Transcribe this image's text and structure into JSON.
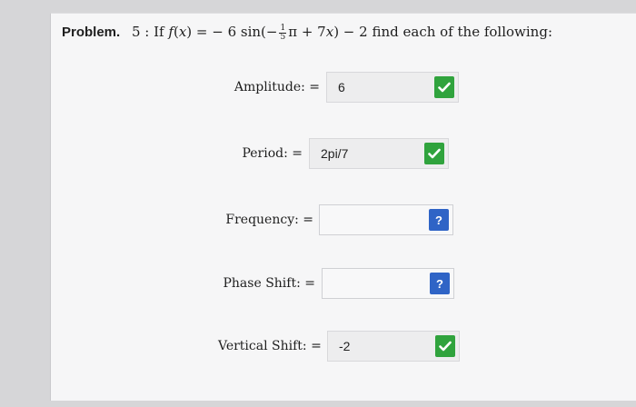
{
  "problem": {
    "label": "Problem.",
    "number": "5",
    "prefix": ": If",
    "func": "f",
    "var": "x",
    "eq_coef": "= − 6 sin",
    "open": "(−",
    "frac_num": "1",
    "frac_den": "5",
    "pi_plus": "π + 7",
    "close_minus": ") − 2",
    "suffix": "find each of the following:"
  },
  "fields": [
    {
      "label": "Amplitude: =",
      "value": "6",
      "status": "correct"
    },
    {
      "label": "Period: =",
      "value": "2pi/7",
      "status": "correct"
    },
    {
      "label": "Frequency: =",
      "value": "",
      "status": "unknown",
      "status_glyph": "?"
    },
    {
      "label": "Phase Shift: =",
      "value": "",
      "status": "unknown",
      "status_glyph": "?"
    },
    {
      "label": "Vertical Shift: =",
      "value": "-2",
      "status": "correct"
    }
  ],
  "icons": {
    "correct": "checkmark-icon",
    "unknown": "question-mark-icon"
  },
  "colors": {
    "correct": "#30a33d",
    "unknown": "#2f64c6"
  }
}
